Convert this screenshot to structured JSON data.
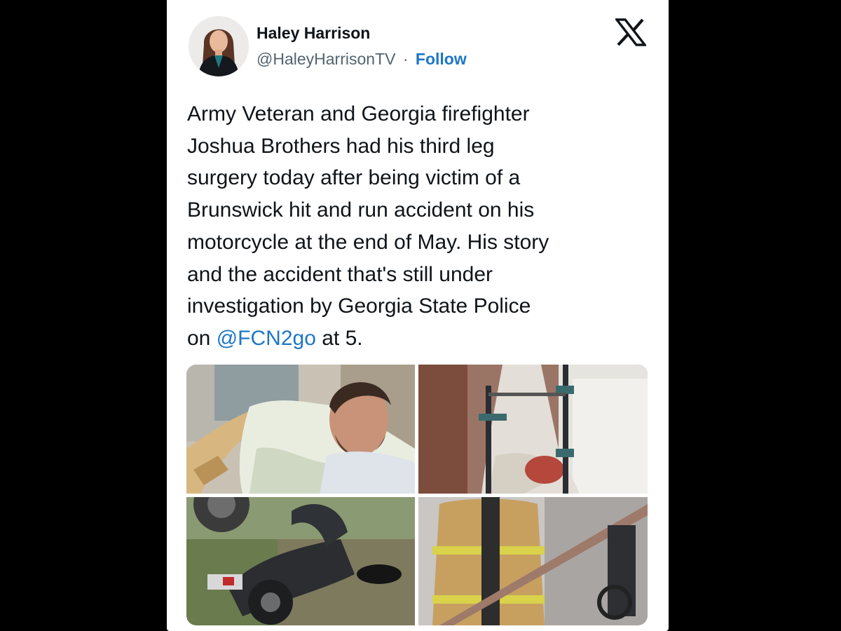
{
  "author": {
    "name": "Haley Harrison",
    "handle": "@HaleyHarrisonTV",
    "separator": "·",
    "follow_label": "Follow"
  },
  "platform_icon": "x-logo-icon",
  "tweet": {
    "lines": [
      "Army Veteran and Georgia firefighter",
      "Joshua Brothers had his third leg",
      "surgery today after being victim of a",
      "Brunswick hit and run accident on his",
      "motorcycle at the end of May. His story",
      "and the accident that's still under",
      "investigation by Georgia State Police"
    ],
    "last_line_prefix": "on ",
    "mention": "@FCN2go",
    "last_line_suffix": " at 5."
  },
  "media": [
    {
      "name": "photo-hospital-bed-selfie"
    },
    {
      "name": "photo-leg-external-fixator"
    },
    {
      "name": "photo-wrecked-motorcycle"
    },
    {
      "name": "photo-firefighter-gear"
    }
  ],
  "colors": {
    "background": "#000000",
    "card": "#ffffff",
    "text": "#0f1419",
    "secondary_text": "#536471",
    "link": "#1d77c7"
  }
}
